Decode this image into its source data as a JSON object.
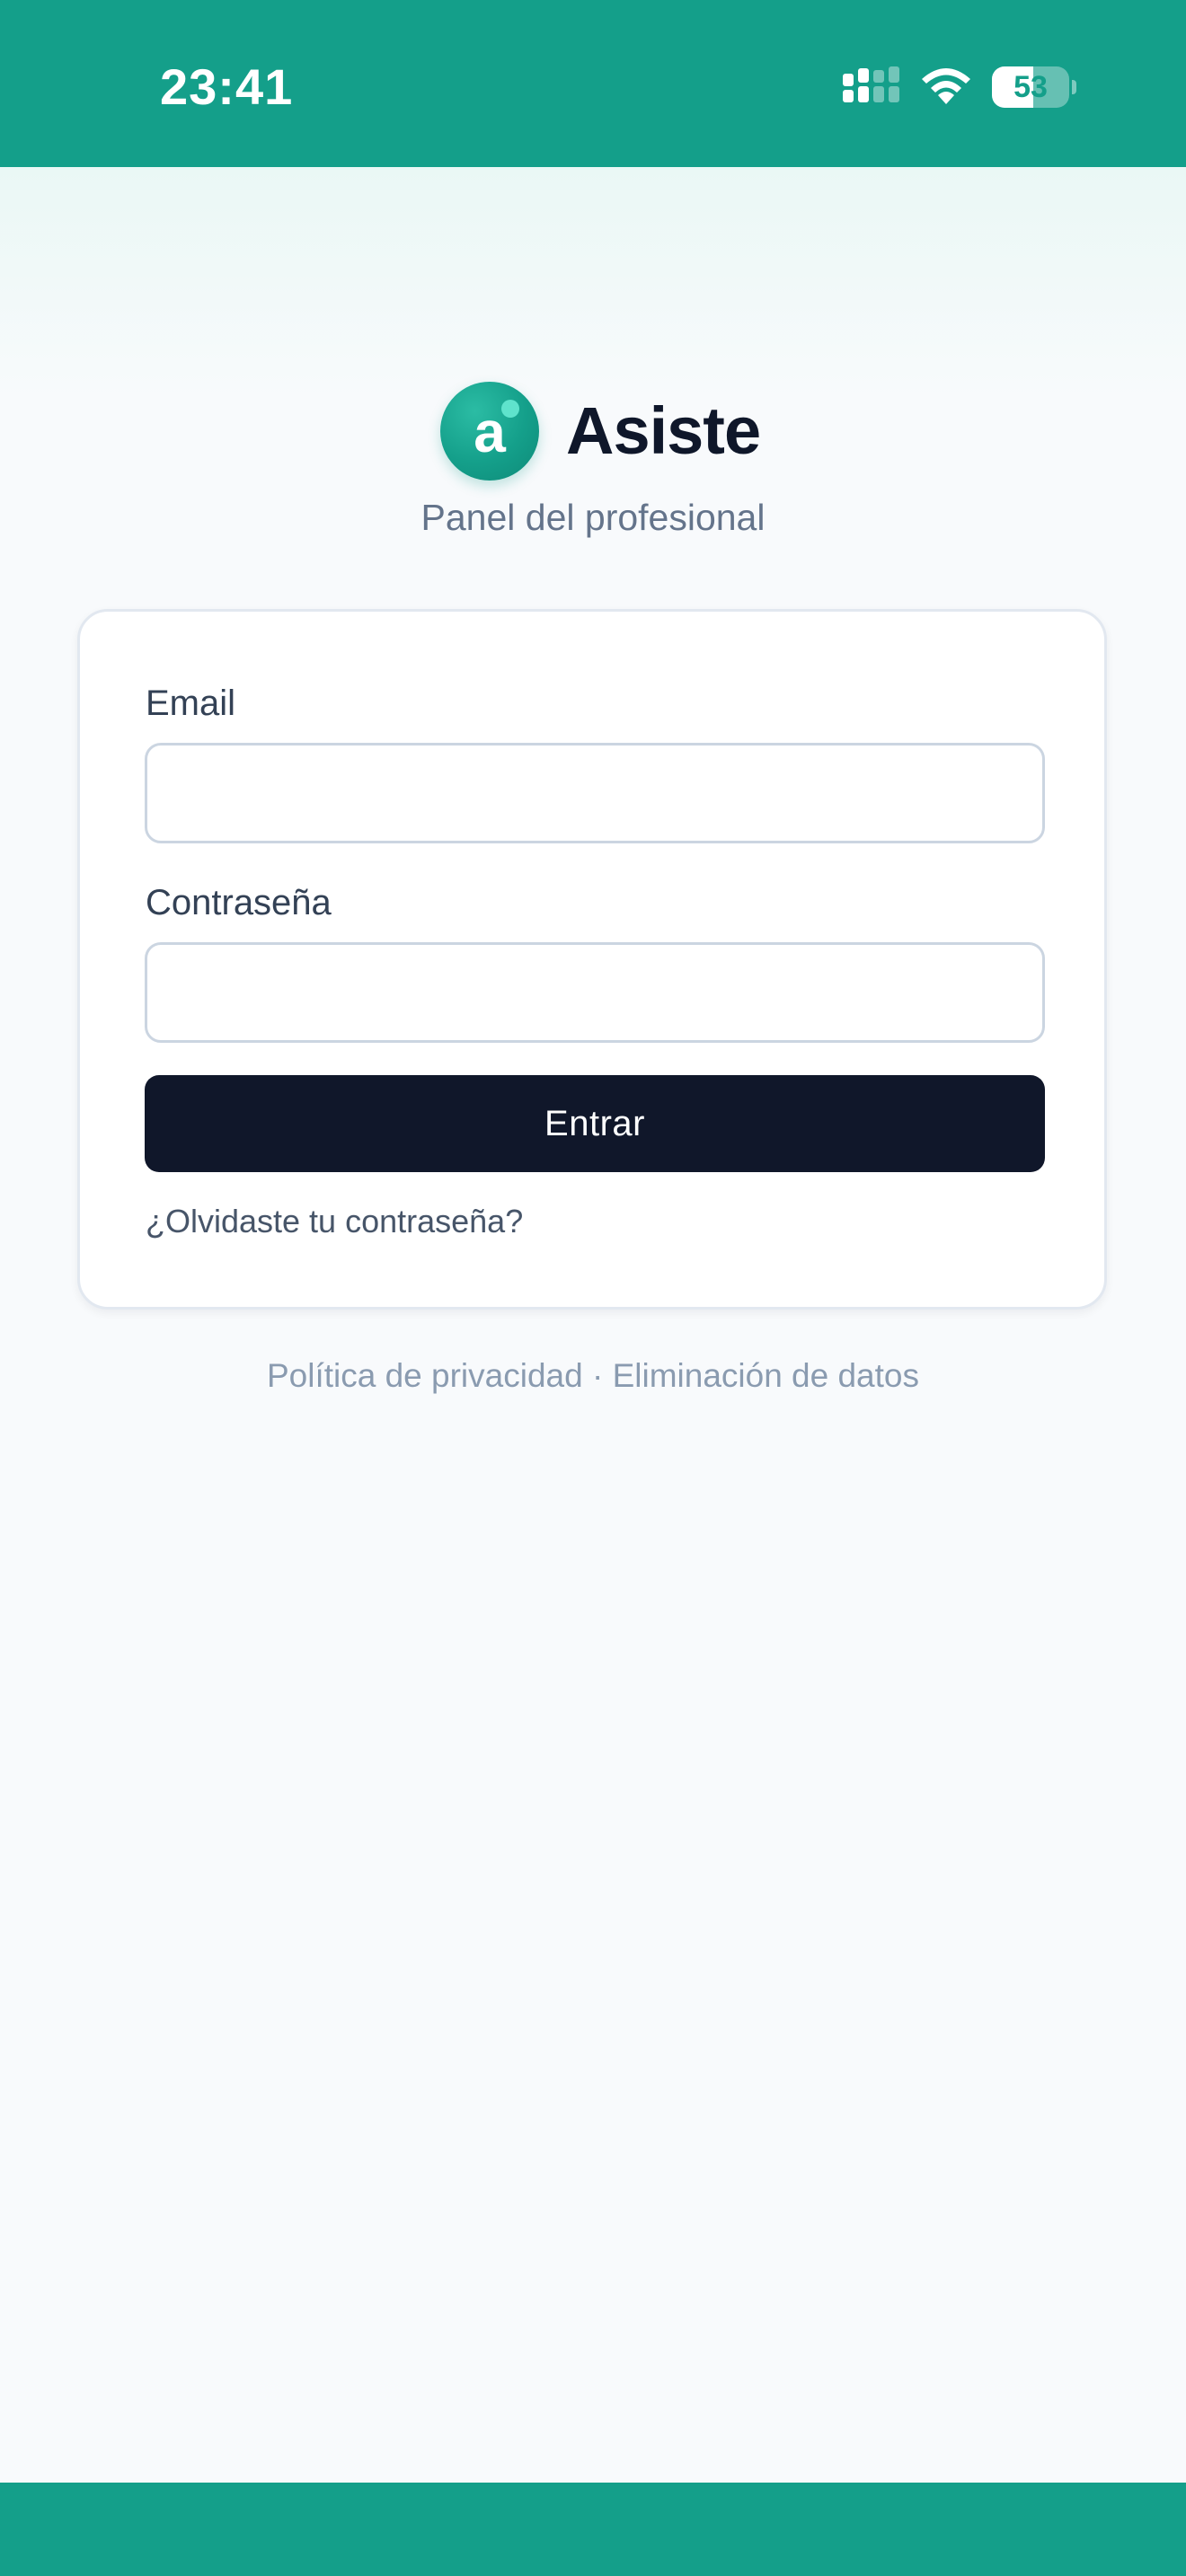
{
  "status_bar": {
    "time": "23:41",
    "battery_level": "53",
    "battery_fraction": 0.53,
    "background_color": "#149f8a",
    "icons": [
      "signal-icon",
      "wifi-icon",
      "battery-icon"
    ]
  },
  "brand": {
    "logo_letter": "a",
    "name": "Asiste",
    "subtitle": "Panel del profesional",
    "accent_color": "#149f8a"
  },
  "login_form": {
    "email_label": "Email",
    "email_value": "",
    "password_label": "Contraseña",
    "password_value": "",
    "submit_label": "Entrar",
    "submit_color": "#10172a",
    "forgot_password": "¿Olvidaste tu contraseña?"
  },
  "footer": {
    "privacy": "Política de privacidad",
    "separator": "·",
    "data_deletion": "Eliminación de datos"
  }
}
